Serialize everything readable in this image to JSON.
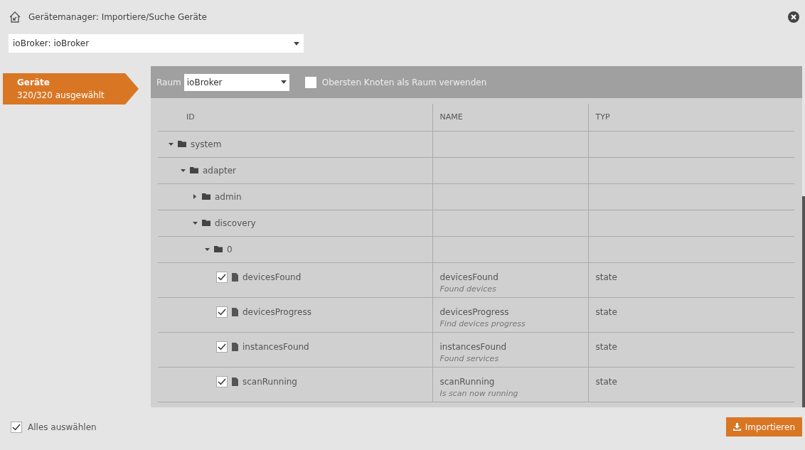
{
  "window": {
    "title": "Gerätemanager: Importiere/Suche Geräte"
  },
  "instance_select": {
    "value": "ioBroker: ioBroker"
  },
  "sidebar": {
    "items": [
      {
        "label": "Geräte",
        "sublabel": "320/320 ausgewählt",
        "selected": true
      }
    ]
  },
  "toolbar": {
    "room_label": "Raum",
    "room_select": {
      "value": "ioBroker"
    },
    "top_node_option": {
      "label": "Obersten Knoten als Raum verwenden",
      "checked": false
    }
  },
  "table": {
    "columns": [
      "ID",
      "NAME",
      "TYP"
    ],
    "rows": [
      {
        "kind": "folder",
        "id": "system",
        "expanded": true,
        "children": [
          {
            "kind": "folder",
            "id": "adapter",
            "expanded": true,
            "children": [
              {
                "kind": "folder",
                "id": "admin",
                "expanded": false
              },
              {
                "kind": "folder",
                "id": "discovery",
                "expanded": true,
                "children": [
                  {
                    "kind": "folder",
                    "id": "0",
                    "expanded": true,
                    "children": [
                      {
                        "kind": "state",
                        "id": "devicesFound",
                        "checked": true,
                        "name": "devicesFound",
                        "description": "Found devices",
                        "type": "state"
                      },
                      {
                        "kind": "state",
                        "id": "devicesProgress",
                        "checked": true,
                        "name": "devicesProgress",
                        "description": "Find devices progress",
                        "type": "state"
                      },
                      {
                        "kind": "state",
                        "id": "instancesFound",
                        "checked": true,
                        "name": "instancesFound",
                        "description": "Found services",
                        "type": "state"
                      },
                      {
                        "kind": "state",
                        "id": "scanRunning",
                        "checked": true,
                        "name": "scanRunning",
                        "description": "Is scan now running",
                        "type": "state"
                      }
                    ]
                  }
                ]
              }
            ]
          }
        ]
      }
    ]
  },
  "footer": {
    "select_all": {
      "label": "Alles auswählen",
      "checked": true
    },
    "import_button": {
      "label": "Importieren"
    }
  }
}
